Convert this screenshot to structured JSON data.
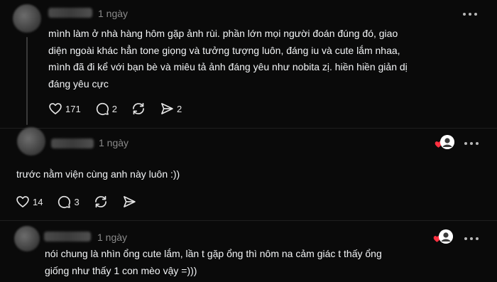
{
  "posts": [
    {
      "time": "1 ngày",
      "text": "mình làm ở nhà hàng hôm gặp ảnh rùi. phần lớn mọi người đoán đúng đó, giao\ndiện ngoài khác hẳn tone giọng và tưởng tượng luôn, đáng iu và cute lắm nhaa,\nmình đã đi kể với bạn bè và miêu tả ảnh đáng yêu như nobita zị. hiền hiền giản dị\nđáng yêu cực",
      "likes": "171",
      "replies": "2",
      "shares": "2"
    },
    {
      "time": "1 ngày",
      "text": "trước nằm viện cùng anh này luôn :))",
      "likes": "14",
      "replies": "3"
    },
    {
      "time": "1 ngày",
      "text": "nói chung là nhìn ổng cute lắm, lần t gặp ổng thì nôm na cảm giác t thấy ổng\ngiống như thấy 1 con mèo vậy =)))"
    }
  ],
  "colors": {
    "background": "#0a0a0a",
    "text": "#f3f5f7",
    "muted": "#8a8a8a",
    "heart_red": "#ff3040"
  },
  "icons": {
    "like": "heart-outline-icon",
    "reply": "speech-bubble-icon",
    "repost": "repost-arrows-icon",
    "share": "send-arrow-icon",
    "more": "more-horizontal-icon",
    "liked_by_author": "red-heart-icon"
  }
}
